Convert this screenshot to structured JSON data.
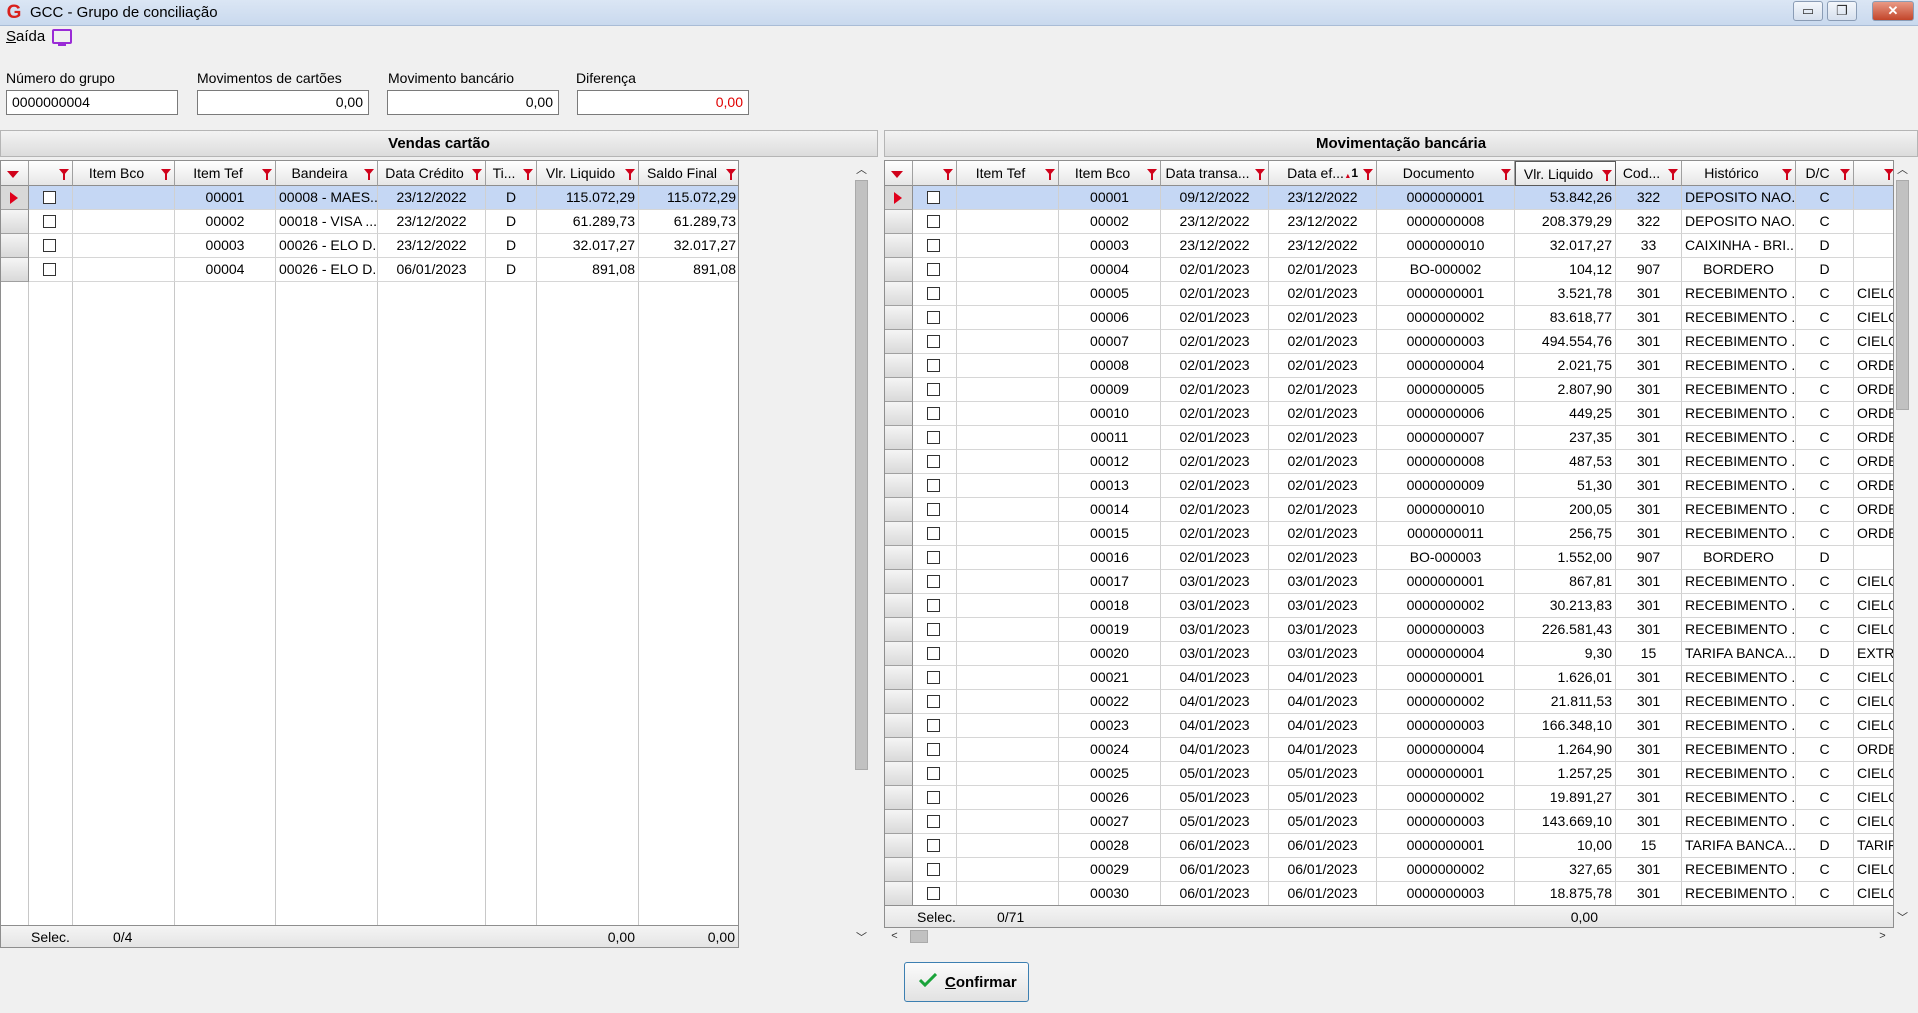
{
  "window": {
    "title": "GCC - Grupo de conciliação",
    "app_logo": "G",
    "minimize": "▭",
    "restore": "❐",
    "close": "✕"
  },
  "menu": {
    "saida_first": "S",
    "saida_rest": "aída"
  },
  "header_fields": {
    "numero_grupo": {
      "label": "Número do grupo",
      "value": "0000000004"
    },
    "mov_cartoes": {
      "label": "Movimentos de cartões",
      "value": "0,00"
    },
    "mov_bancario": {
      "label": "Movimento bancário",
      "value": "0,00"
    },
    "diferenca": {
      "label": "Diferença",
      "value": "0,00",
      "color": "#e00000"
    }
  },
  "vendas": {
    "title": "Vendas cartão",
    "columns": [
      "Item Bco",
      "Item Tef",
      "Bandeira",
      "Data Crédito",
      "Ti...",
      "Vlr. Liquido",
      "Saldo Final"
    ],
    "rows": [
      {
        "item_bco": "",
        "item_tef": "00001",
        "bandeira": "00008 - MAES...",
        "data_credito": "23/12/2022",
        "ti": "D",
        "vlr_liquido": "115.072,29",
        "saldo_final": "115.072,29"
      },
      {
        "item_bco": "",
        "item_tef": "00002",
        "bandeira": "00018 - VISA ...",
        "data_credito": "23/12/2022",
        "ti": "D",
        "vlr_liquido": "61.289,73",
        "saldo_final": "61.289,73"
      },
      {
        "item_bco": "",
        "item_tef": "00003",
        "bandeira": "00026 - ELO D...",
        "data_credito": "23/12/2022",
        "ti": "D",
        "vlr_liquido": "32.017,27",
        "saldo_final": "32.017,27"
      },
      {
        "item_bco": "",
        "item_tef": "00004",
        "bandeira": "00026 - ELO D...",
        "data_credito": "06/01/2023",
        "ti": "D",
        "vlr_liquido": "891,08",
        "saldo_final": "891,08"
      }
    ],
    "footer": {
      "label": "Selec.",
      "count": "0/4",
      "total_vlr": "0,00",
      "total_saldo": "0,00"
    }
  },
  "movimentacao": {
    "title": "Movimentação bancária",
    "columns": [
      "Item Tef",
      "Item Bco",
      "Data transa...",
      "Data ef...",
      "Documento",
      "Vlr. Liquido",
      "Cod...",
      "Histórico",
      "D/C"
    ],
    "sort_indicator": "1",
    "rows": [
      [
        "",
        "00001",
        "09/12/2022",
        "23/12/2022",
        "0000000001",
        "53.842,26",
        "322",
        "DEPOSITO NAO...",
        "C",
        ""
      ],
      [
        "",
        "00002",
        "23/12/2022",
        "23/12/2022",
        "0000000008",
        "208.379,29",
        "322",
        "DEPOSITO NAO...",
        "C",
        ""
      ],
      [
        "",
        "00003",
        "23/12/2022",
        "23/12/2022",
        "0000000010",
        "32.017,27",
        "33",
        "CAIXINHA - BRI...",
        "D",
        ""
      ],
      [
        "",
        "00004",
        "02/01/2023",
        "02/01/2023",
        "BO-000002",
        "104,12",
        "907",
        "BORDERO",
        "D",
        ""
      ],
      [
        "",
        "00005",
        "02/01/2023",
        "02/01/2023",
        "0000000001",
        "3.521,78",
        "301",
        "RECEBIMENTO ...",
        "C",
        "CIELO"
      ],
      [
        "",
        "00006",
        "02/01/2023",
        "02/01/2023",
        "0000000002",
        "83.618,77",
        "301",
        "RECEBIMENTO ...",
        "C",
        "CIELO"
      ],
      [
        "",
        "00007",
        "02/01/2023",
        "02/01/2023",
        "0000000003",
        "494.554,76",
        "301",
        "RECEBIMENTO ...",
        "C",
        "CIELO"
      ],
      [
        "",
        "00008",
        "02/01/2023",
        "02/01/2023",
        "0000000004",
        "2.021,75",
        "301",
        "RECEBIMENTO ...",
        "C",
        "ORDE"
      ],
      [
        "",
        "00009",
        "02/01/2023",
        "02/01/2023",
        "0000000005",
        "2.807,90",
        "301",
        "RECEBIMENTO ...",
        "C",
        "ORDE"
      ],
      [
        "",
        "00010",
        "02/01/2023",
        "02/01/2023",
        "0000000006",
        "449,25",
        "301",
        "RECEBIMENTO ...",
        "C",
        "ORDE"
      ],
      [
        "",
        "00011",
        "02/01/2023",
        "02/01/2023",
        "0000000007",
        "237,35",
        "301",
        "RECEBIMENTO ...",
        "C",
        "ORDE"
      ],
      [
        "",
        "00012",
        "02/01/2023",
        "02/01/2023",
        "0000000008",
        "487,53",
        "301",
        "RECEBIMENTO ...",
        "C",
        "ORDE"
      ],
      [
        "",
        "00013",
        "02/01/2023",
        "02/01/2023",
        "0000000009",
        "51,30",
        "301",
        "RECEBIMENTO ...",
        "C",
        "ORDE"
      ],
      [
        "",
        "00014",
        "02/01/2023",
        "02/01/2023",
        "0000000010",
        "200,05",
        "301",
        "RECEBIMENTO ...",
        "C",
        "ORDE"
      ],
      [
        "",
        "00015",
        "02/01/2023",
        "02/01/2023",
        "0000000011",
        "256,75",
        "301",
        "RECEBIMENTO ...",
        "C",
        "ORDE"
      ],
      [
        "",
        "00016",
        "02/01/2023",
        "02/01/2023",
        "BO-000003",
        "1.552,00",
        "907",
        "BORDERO",
        "D",
        ""
      ],
      [
        "",
        "00017",
        "03/01/2023",
        "03/01/2023",
        "0000000001",
        "867,81",
        "301",
        "RECEBIMENTO ...",
        "C",
        "CIELO"
      ],
      [
        "",
        "00018",
        "03/01/2023",
        "03/01/2023",
        "0000000002",
        "30.213,83",
        "301",
        "RECEBIMENTO ...",
        "C",
        "CIELO"
      ],
      [
        "",
        "00019",
        "03/01/2023",
        "03/01/2023",
        "0000000003",
        "226.581,43",
        "301",
        "RECEBIMENTO ...",
        "C",
        "CIELO"
      ],
      [
        "",
        "00020",
        "03/01/2023",
        "03/01/2023",
        "0000000004",
        "9,30",
        "15",
        "TARIFA BANCA...",
        "D",
        "EXTRA"
      ],
      [
        "",
        "00021",
        "04/01/2023",
        "04/01/2023",
        "0000000001",
        "1.626,01",
        "301",
        "RECEBIMENTO ...",
        "C",
        "CIELO"
      ],
      [
        "",
        "00022",
        "04/01/2023",
        "04/01/2023",
        "0000000002",
        "21.811,53",
        "301",
        "RECEBIMENTO ...",
        "C",
        "CIELO"
      ],
      [
        "",
        "00023",
        "04/01/2023",
        "04/01/2023",
        "0000000003",
        "166.348,10",
        "301",
        "RECEBIMENTO ...",
        "C",
        "CIELO"
      ],
      [
        "",
        "00024",
        "04/01/2023",
        "04/01/2023",
        "0000000004",
        "1.264,90",
        "301",
        "RECEBIMENTO ...",
        "C",
        "ORDE"
      ],
      [
        "",
        "00025",
        "05/01/2023",
        "05/01/2023",
        "0000000001",
        "1.257,25",
        "301",
        "RECEBIMENTO ...",
        "C",
        "CIELO"
      ],
      [
        "",
        "00026",
        "05/01/2023",
        "05/01/2023",
        "0000000002",
        "19.891,27",
        "301",
        "RECEBIMENTO ...",
        "C",
        "CIELO"
      ],
      [
        "",
        "00027",
        "05/01/2023",
        "05/01/2023",
        "0000000003",
        "143.669,10",
        "301",
        "RECEBIMENTO ...",
        "C",
        "CIELO"
      ],
      [
        "",
        "00028",
        "06/01/2023",
        "06/01/2023",
        "0000000001",
        "10,00",
        "15",
        "TARIFA BANCA...",
        "D",
        "TARIF."
      ],
      [
        "",
        "00029",
        "06/01/2023",
        "06/01/2023",
        "0000000002",
        "327,65",
        "301",
        "RECEBIMENTO ...",
        "C",
        "CIELO"
      ],
      [
        "",
        "00030",
        "06/01/2023",
        "06/01/2023",
        "0000000003",
        "18.875,78",
        "301",
        "RECEBIMENTO ...",
        "C",
        "CIELO"
      ]
    ],
    "footer": {
      "label": "Selec.",
      "count": "0/71",
      "total_vlr": "0,00"
    }
  },
  "confirm": {
    "first": "C",
    "rest": "onfirmar"
  },
  "colors": {
    "accent_red": "#d0021b",
    "selection": "#c5d7f4",
    "button_border": "#3c7fb1"
  }
}
